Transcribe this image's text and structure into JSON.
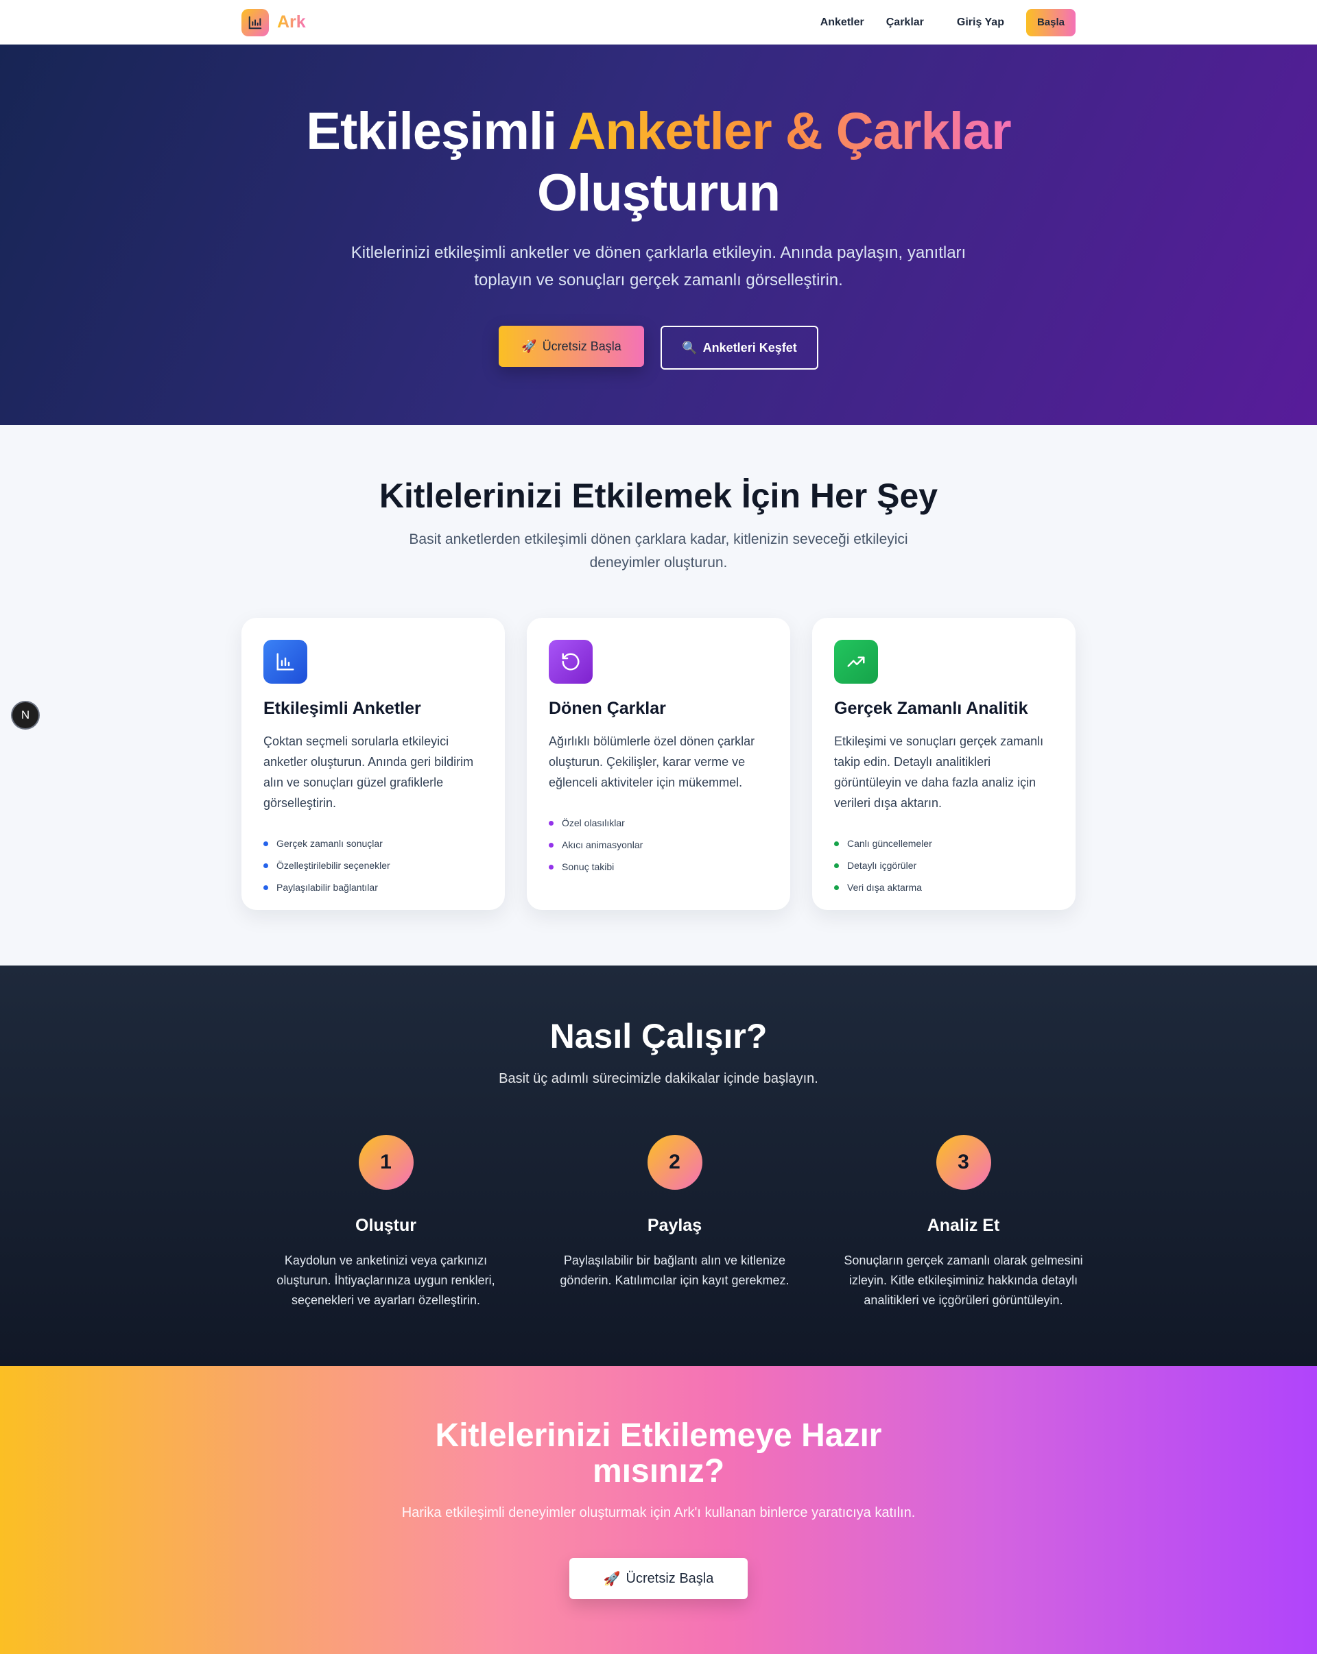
{
  "nav": {
    "brand": "Ark",
    "links": [
      "Anketler",
      "Çarklar"
    ],
    "login": "Giriş Yap",
    "cta": "Başla"
  },
  "hero": {
    "title_part1": "Etkileşimli",
    "title_highlight": "Anketler & Çarklar",
    "title_part2": "Oluşturun",
    "subtitle": "Kitlelerinizi etkileşimli anketler ve dönen çarklarla etkileyin. Anında paylaşın, yanıtları toplayın ve sonuçları gerçek zamanlı görselleştirin.",
    "primary_button": "Ücretsiz Başla",
    "primary_button_emoji": "🚀",
    "secondary_button": "Anketleri Keşfet",
    "secondary_button_emoji": "🔍"
  },
  "features": {
    "title": "Kitlelerinizi Etkilemek İçin Her Şey",
    "subtitle": "Basit anketlerden etkileşimli dönen çarklara kadar, kitlenizin seveceği etkileyici deneyimler oluşturun.",
    "cards": [
      {
        "icon": "bar-chart-icon",
        "color": "#2563eb",
        "title": "Etkileşimli Anketler",
        "description": "Çoktan seçmeli sorularla etkileyici anketler oluşturun. Anında geri bildirim alın ve sonuçları güzel grafiklerle görselleştirin.",
        "items": [
          "Gerçek zamanlı sonuçlar",
          "Özelleştirilebilir seçenekler",
          "Paylaşılabilir bağlantılar"
        ]
      },
      {
        "icon": "rotate-icon",
        "color": "#9333ea",
        "title": "Dönen Çarklar",
        "description": "Ağırlıklı bölümlerle özel dönen çarklar oluşturun. Çekilişler, karar verme ve eğlenceli aktiviteler için mükemmel.",
        "items": [
          "Özel olasılıklar",
          "Akıcı animasyonlar",
          "Sonuç takibi"
        ]
      },
      {
        "icon": "trending-up-icon",
        "color": "#16a34a",
        "title": "Gerçek Zamanlı Analitik",
        "description": "Etkileşimi ve sonuçları gerçek zamanlı takip edin. Detaylı analitikleri görüntüleyin ve daha fazla analiz için verileri dışa aktarın.",
        "items": [
          "Canlı güncellemeler",
          "Detaylı içgörüler",
          "Veri dışa aktarma"
        ]
      }
    ]
  },
  "dev_badge": "N",
  "how": {
    "title": "Nasıl Çalışır?",
    "subtitle": "Basit üç adımlı sürecimizle dakikalar içinde başlayın.",
    "steps": [
      {
        "number": "1",
        "title": "Oluştur",
        "description": "Kaydolun ve anketinizi veya çarkınızı oluşturun. İhtiyaçlarınıza uygun renkleri, seçenekleri ve ayarları özelleştirin."
      },
      {
        "number": "2",
        "title": "Paylaş",
        "description": "Paylaşılabilir bir bağlantı alın ve kitlenize gönderin. Katılımcılar için kayıt gerekmez."
      },
      {
        "number": "3",
        "title": "Analiz Et",
        "description": "Sonuçların gerçek zamanlı olarak gelmesini izleyin. Kitle etkileşiminiz hakkında detaylı analitikleri ve içgörüleri görüntüleyin."
      }
    ]
  },
  "cta": {
    "title": "Kitlelerinizi Etkilemeye Hazır mısınız?",
    "subtitle": "Harika etkileşimli deneyimler oluşturmak için Ark'ı kullanan binlerce yaratıcıya katılın.",
    "button": "Ücretsiz Başla",
    "button_emoji": "🚀"
  }
}
